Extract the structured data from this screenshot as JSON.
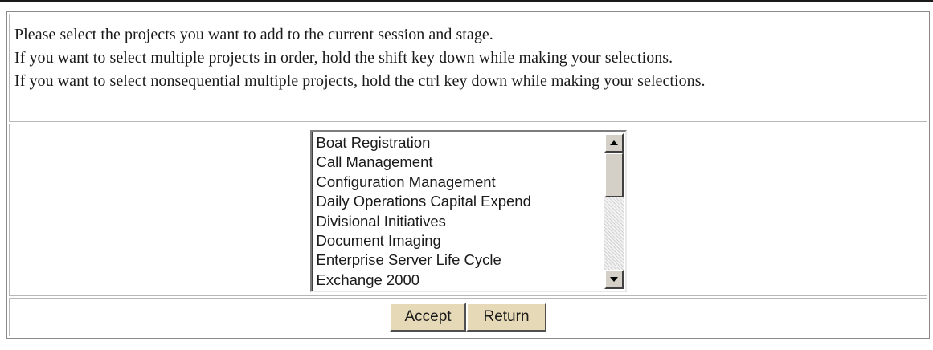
{
  "instructions": [
    "Please select the projects you want to add to the current session and stage.",
    "If you want to select multiple projects in order, hold the shift key down while making your selections.",
    "If you want to select nonsequential multiple projects, hold the ctrl key down while making your selections."
  ],
  "projects": {
    "items": [
      "Boat Registration",
      "Call Management",
      "Configuration Management",
      "Daily Operations Capital Expend",
      "Divisional Initiatives",
      "Document Imaging",
      "Enterprise Server Life Cycle",
      "Exchange 2000"
    ]
  },
  "scrollbar": {
    "up_icon": "arrow-up-icon",
    "down_icon": "arrow-down-icon"
  },
  "buttons": {
    "accept_label": "Accept",
    "return_label": "Return"
  },
  "colors": {
    "button_bg": "#e6d9b7",
    "border": "#8a8a8a",
    "text": "#1a1a1a"
  }
}
